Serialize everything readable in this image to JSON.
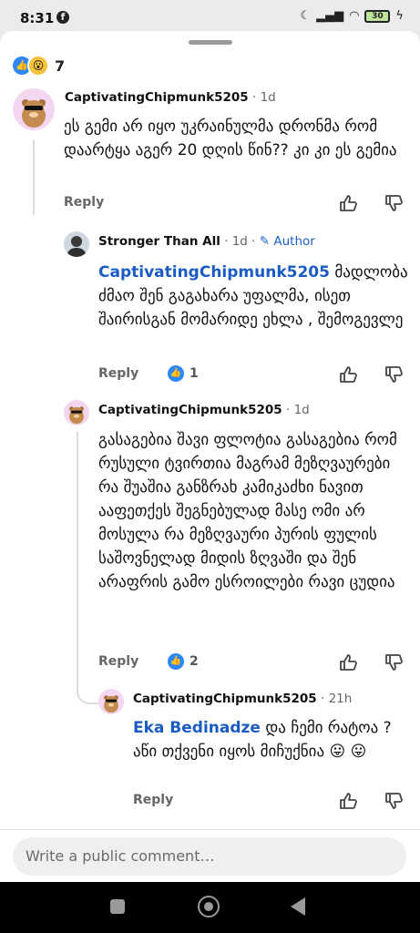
{
  "status_bar": {
    "time": "8:31",
    "battery": "30"
  },
  "reactions": {
    "count": "7"
  },
  "comments": [
    {
      "author": "CaptivatingChipmunk5205",
      "age": "1d",
      "text": "ეს გემი არ იყო უკრაინულმა დრონმა რომ დაარტყა აგერ 20 დღის წინ?? კი კი ეს გემია",
      "reply_label": "Reply"
    },
    {
      "author": "Stronger Than All",
      "age": "1d",
      "author_badge": "Author",
      "mention": "CaptivatingChipmunk5205",
      "text": "მადლობა ძმაო შენ გაგახარა უფალმა, ისეთ შაირისგან მომარიდე ეხლა , შემოგევლე",
      "reply_label": "Reply",
      "likes": "1"
    },
    {
      "author": "CaptivatingChipmunk5205",
      "age": "1d",
      "text": "გასაგებია შავი ფლოტია გასაგებია რომ რუსული ტვირთია მაგრამ მეზღვაურები რა შუაშია განზრახ კამიკაძხი ნავით ააფეთქეს შეგნებულად მასე ომი არ მოსულა რა მეზღვაური პურის ფულის საშოვნელად მიდის ზღვაში და შენ არაფრის გამო ესროილები რავი ცუდია",
      "reply_label": "Reply",
      "likes": "2"
    },
    {
      "author": "CaptivatingChipmunk5205",
      "age": "21h",
      "mention": "Eka Bedinadze",
      "text": "და ჩემი რატოა ? აწი თქვენი იყოს მიჩუქნია 😛 😛",
      "reply_label": "Reply"
    }
  ],
  "composer": {
    "placeholder": "Write a public comment…"
  },
  "colors": {
    "accent": "#1a5bc4",
    "like_blue": "#2d88ff"
  }
}
